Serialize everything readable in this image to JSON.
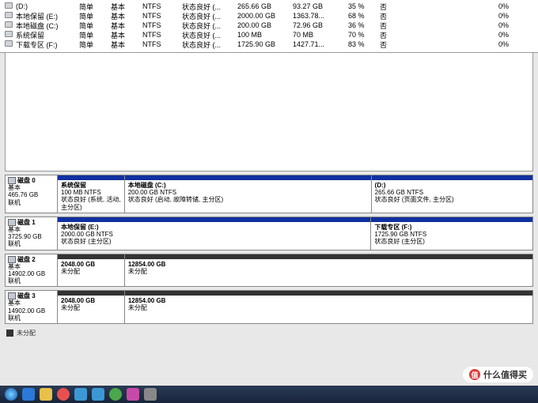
{
  "volumes": [
    {
      "name": "(D:)",
      "layout": "简单",
      "type": "基本",
      "fs": "NTFS",
      "status": "状态良好 (...",
      "capacity": "265.66 GB",
      "free": "93.27 GB",
      "pct": "35 %",
      "fault": "否",
      "x2": "0%"
    },
    {
      "name": "本地保留 (E:)",
      "layout": "简单",
      "type": "基本",
      "fs": "NTFS",
      "status": "状态良好 (...",
      "capacity": "2000.00 GB",
      "free": "1363.78...",
      "pct": "68 %",
      "fault": "否",
      "x2": "0%"
    },
    {
      "name": "本地磁盘 (C:)",
      "layout": "简单",
      "type": "基本",
      "fs": "NTFS",
      "status": "状态良好 (...",
      "capacity": "200.00 GB",
      "free": "72.96 GB",
      "pct": "36 %",
      "fault": "否",
      "x2": "0%"
    },
    {
      "name": "系统保留",
      "layout": "简单",
      "type": "基本",
      "fs": "NTFS",
      "status": "状态良好 (...",
      "capacity": "100 MB",
      "free": "70 MB",
      "pct": "70 %",
      "fault": "否",
      "x2": "0%"
    },
    {
      "name": "下载专区 (F:)",
      "layout": "简单",
      "type": "基本",
      "fs": "NTFS",
      "status": "状态良好 (...",
      "capacity": "1725.90 GB",
      "free": "1427.71...",
      "pct": "83 %",
      "fault": "否",
      "x2": "0%"
    }
  ],
  "disks": [
    {
      "title": "磁盘 0",
      "type": "基本",
      "size": "465.76 GB",
      "state": "联机",
      "parts": [
        {
          "flex": 14,
          "l1": "系统保留",
          "l2": "100 MB NTFS",
          "l3": "状态良好 (系统, 活动, 主分区)",
          "head": "blue"
        },
        {
          "flex": 52,
          "l1": "本地磁盘 (C:)",
          "l2": "200.00 GB NTFS",
          "l3": "状态良好 (启动, 故障转储, 主分区)",
          "head": "blue"
        },
        {
          "flex": 34,
          "l1": "(D:)",
          "l2": "265.66 GB NTFS",
          "l3": "状态良好 (页面文件, 主分区)",
          "head": "blue"
        }
      ]
    },
    {
      "title": "磁盘 1",
      "type": "基本",
      "size": "3725.90 GB",
      "state": "联机",
      "parts": [
        {
          "flex": 66,
          "l1": "本地保留 (E:)",
          "l2": "2000.00 GB NTFS",
          "l3": "状态良好 (主分区)",
          "head": "blue"
        },
        {
          "flex": 34,
          "l1": "下载专区 (F:)",
          "l2": "1725.90 GB NTFS",
          "l3": "状态良好 (主分区)",
          "head": "blue"
        }
      ]
    },
    {
      "title": "磁盘 2",
      "type": "基本",
      "size": "14902.00 GB",
      "state": "联机",
      "parts": [
        {
          "flex": 14,
          "l1": "2048.00 GB",
          "l2": "未分配",
          "l3": "",
          "head": "gray"
        },
        {
          "flex": 86,
          "l1": "12854.00 GB",
          "l2": "未分配",
          "l3": "",
          "head": "gray"
        }
      ]
    },
    {
      "title": "磁盘 3",
      "type": "基本",
      "size": "14902.00 GB",
      "state": "联机",
      "parts": [
        {
          "flex": 14,
          "l1": "2048.00 GB",
          "l2": "未分配",
          "l3": "",
          "head": "gray"
        },
        {
          "flex": 86,
          "l1": "12854.00 GB",
          "l2": "未分配",
          "l3": "",
          "head": "gray"
        }
      ]
    }
  ],
  "legend": {
    "unalloc": "未分配"
  },
  "watermark": {
    "badge": "值",
    "text": "什么值得买"
  }
}
